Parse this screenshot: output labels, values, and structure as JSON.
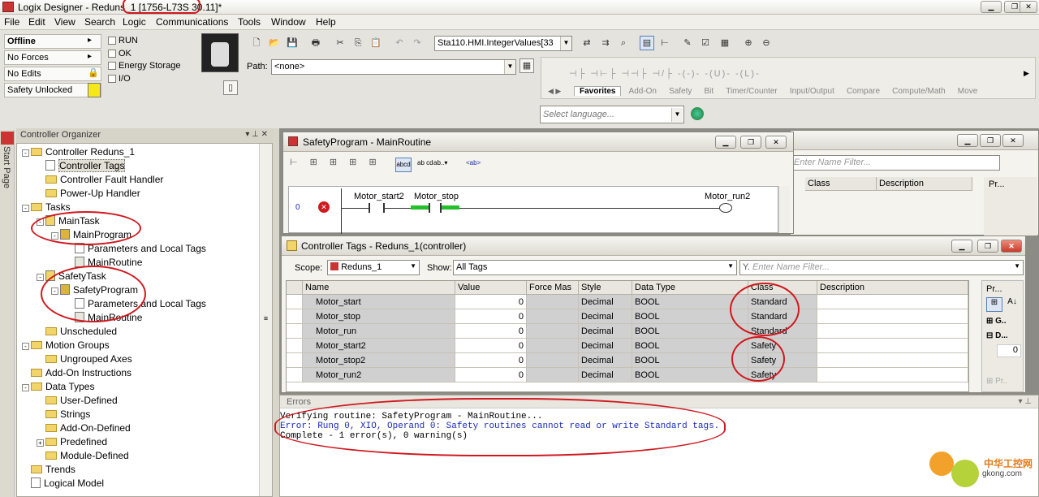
{
  "window": {
    "title": "Logix Designer - Reduns_1 [1756-L73S 30.11]*",
    "icon": "logix-app-icon",
    "minimize": "minimize-icon",
    "restore": "restore-icon",
    "close": "close-icon"
  },
  "menu": [
    "File",
    "Edit",
    "View",
    "Search",
    "Logic",
    "Communications",
    "Tools",
    "Window",
    "Help"
  ],
  "status": {
    "mode": "Offline",
    "forces": "No Forces",
    "edits": "No Edits",
    "safety": "Safety Unlocked",
    "leds": [
      "RUN",
      "OK",
      "Energy Storage",
      "I/O"
    ]
  },
  "toolbar": {
    "tag_combo": "Sta110.HMI.IntegerValues[33",
    "path_label": "Path:",
    "path_value": "<none>"
  },
  "palette": {
    "tabs": [
      "Favorites",
      "Add-On",
      "Safety",
      "Bit",
      "Timer/Counter",
      "Input/Output",
      "Compare",
      "Compute/Math",
      "Move"
    ],
    "lang_placeholder": "Select language..."
  },
  "organizer": {
    "title": "Controller Organizer",
    "start_page": "Start Page",
    "items": [
      {
        "label": "Controller Reduns_1",
        "indent": 0,
        "pm": "-",
        "icon": "folder-icon"
      },
      {
        "label": "Controller Tags",
        "indent": 1,
        "icon": "tags-icon",
        "selected": true
      },
      {
        "label": "Controller Fault Handler",
        "indent": 1,
        "icon": "folder-icon"
      },
      {
        "label": "Power-Up Handler",
        "indent": 1,
        "icon": "folder-icon"
      },
      {
        "label": "Tasks",
        "indent": 0,
        "pm": "-",
        "icon": "folder-icon"
      },
      {
        "label": "MainTask",
        "indent": 1,
        "pm": "-",
        "icon": "task-icon"
      },
      {
        "label": "MainProgram",
        "indent": 2,
        "pm": "-",
        "icon": "program-icon"
      },
      {
        "label": "Parameters and Local Tags",
        "indent": 3,
        "icon": "tags-icon"
      },
      {
        "label": "MainRoutine",
        "indent": 3,
        "icon": "routine-icon"
      },
      {
        "label": "SafetyTask",
        "indent": 1,
        "pm": "-",
        "icon": "task-icon"
      },
      {
        "label": "SafetyProgram",
        "indent": 2,
        "pm": "-",
        "icon": "program-icon"
      },
      {
        "label": "Parameters and Local Tags",
        "indent": 3,
        "icon": "tags-icon"
      },
      {
        "label": "MainRoutine",
        "indent": 3,
        "icon": "routine-icon"
      },
      {
        "label": "Unscheduled",
        "indent": 1,
        "icon": "folder-icon"
      },
      {
        "label": "Motion Groups",
        "indent": 0,
        "pm": "-",
        "icon": "folder-icon"
      },
      {
        "label": "Ungrouped Axes",
        "indent": 1,
        "icon": "folder-icon"
      },
      {
        "label": "Add-On Instructions",
        "indent": 0,
        "icon": "folder-icon"
      },
      {
        "label": "Data Types",
        "indent": 0,
        "pm": "-",
        "icon": "folder-icon"
      },
      {
        "label": "User-Defined",
        "indent": 1,
        "icon": "folder-icon"
      },
      {
        "label": "Strings",
        "indent": 1,
        "icon": "folder-icon"
      },
      {
        "label": "Add-On-Defined",
        "indent": 1,
        "icon": "folder-icon"
      },
      {
        "label": "Predefined",
        "indent": 1,
        "pm": "+",
        "icon": "folder-icon"
      },
      {
        "label": "Module-Defined",
        "indent": 1,
        "icon": "folder-icon"
      },
      {
        "label": "Trends",
        "indent": 0,
        "icon": "folder-icon"
      },
      {
        "label": "Logical Model",
        "indent": 0,
        "icon": "model-icon"
      }
    ]
  },
  "routine": {
    "title": "SafetyProgram - MainRoutine",
    "rung": "0",
    "contacts": [
      "Motor_start2",
      "Motor_stop"
    ],
    "coil": "Motor_run2"
  },
  "bgwin": {
    "filter": "Enter Name Filter...",
    "cols": [
      "Class",
      "Description"
    ],
    "props": "Pr..."
  },
  "tags": {
    "title": "Controller Tags - Reduns_1(controller)",
    "scope_label": "Scope:",
    "scope_value": "Reduns_1",
    "show_label": "Show:",
    "show_value": "All Tags",
    "filter": "Enter Name Filter...",
    "props": "Pr...",
    "props_val": "0",
    "columns": [
      "Name",
      "Value",
      "Force Mas",
      "Style",
      "Data Type",
      "Class",
      "Description"
    ],
    "rows": [
      [
        "Motor_start",
        "0",
        "",
        "Decimal",
        "BOOL",
        "Standard",
        ""
      ],
      [
        "Motor_stop",
        "0",
        "",
        "Decimal",
        "BOOL",
        "Standard",
        ""
      ],
      [
        "Motor_run",
        "0",
        "",
        "Decimal",
        "BOOL",
        "Standard",
        ""
      ],
      [
        "Motor_start2",
        "0",
        "",
        "Decimal",
        "BOOL",
        "Safety",
        ""
      ],
      [
        "Motor_stop2",
        "0",
        "",
        "Decimal",
        "BOOL",
        "Safety",
        ""
      ],
      [
        "Motor_run2",
        "0",
        "",
        "Decimal",
        "BOOL",
        "Safety",
        ""
      ]
    ]
  },
  "errors": {
    "title": "Errors",
    "lines": [
      "Verifying routine: SafetyProgram - MainRoutine...",
      "Error: Rung 0, XIO, Operand 0: Safety routines cannot read or write Standard tags.",
      "Complete - 1 error(s), 0 warning(s)"
    ]
  },
  "watermark": {
    "cn": "中华工控网",
    "url": "gkong.com"
  },
  "colors": {
    "annotation": "#d0191f",
    "error_text": "#1a2bb8",
    "safety_green": "#22c02a"
  }
}
